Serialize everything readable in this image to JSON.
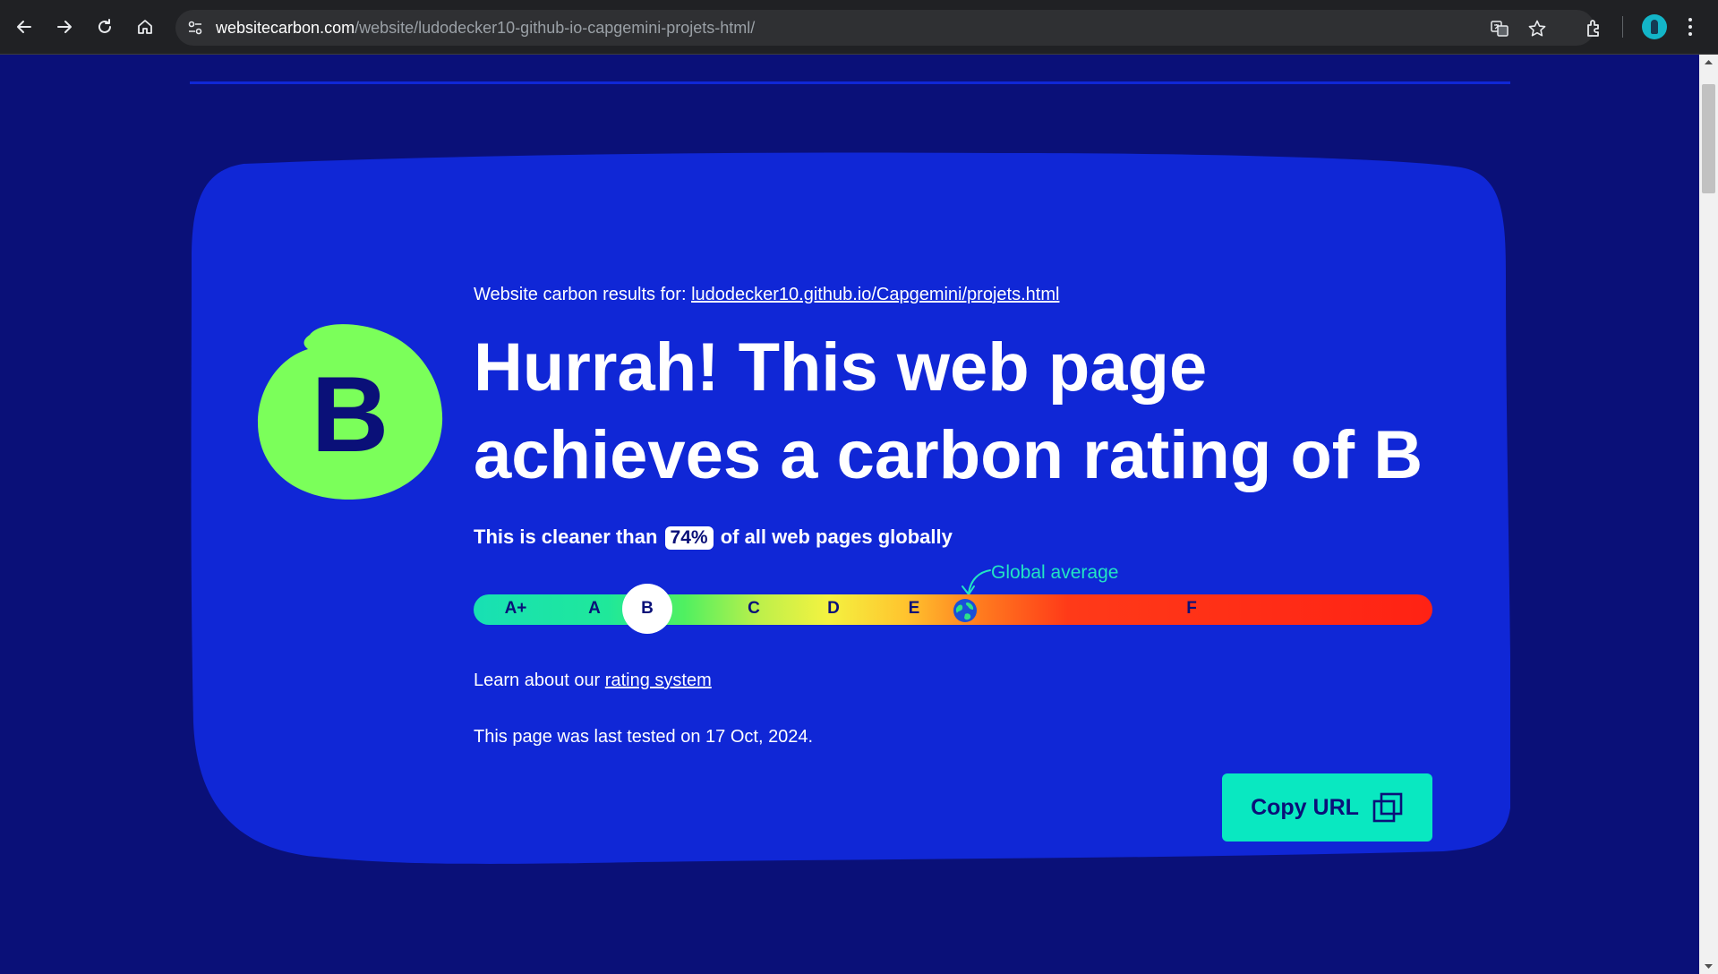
{
  "browser": {
    "url_host": "websitecarbon.com",
    "url_path": "/website/ludodecker10-github-io-capgemini-projets-html/"
  },
  "result": {
    "intro": "Website carbon results for:",
    "link_text": "ludodecker10.github.io/Capgemini/projets.html",
    "grade": "B",
    "headline": "Hurrah! This web page achieves a carbon rating of B",
    "cleaner_prefix": "This is cleaner than",
    "cleaner_percent": "74%",
    "cleaner_suffix": "of all web pages globally",
    "global_average_label": "Global average"
  },
  "scale": {
    "grades": [
      "A+",
      "A",
      "B",
      "C",
      "D",
      "E",
      "F"
    ],
    "current": "B"
  },
  "footer": {
    "learn_prefix": "Learn about our",
    "learn_link": "rating system",
    "tested": "This page was last tested on 17 Oct, 2024.",
    "copy_button": "Copy URL"
  },
  "colors": {
    "background": "#0a1078",
    "card": "#1027d6",
    "grade_badge": "#7bff5a",
    "accent": "#09e8c1"
  }
}
